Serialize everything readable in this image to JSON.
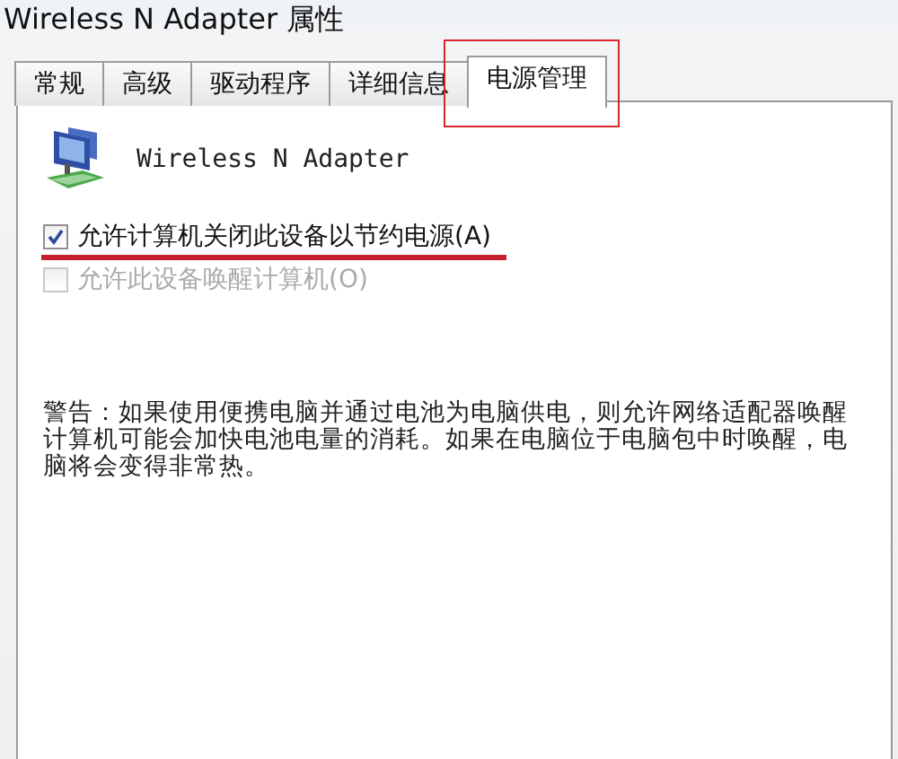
{
  "window": {
    "title": "Wireless N Adapter 属性"
  },
  "tabs": [
    {
      "label": "常规",
      "selected": false
    },
    {
      "label": "高级",
      "selected": false
    },
    {
      "label": "驱动程序",
      "selected": false
    },
    {
      "label": "详细信息",
      "selected": false
    },
    {
      "label": "电源管理",
      "selected": true
    }
  ],
  "device": {
    "name": "Wireless N Adapter"
  },
  "options": [
    {
      "label": "允许计算机关闭此设备以节约电源(A)",
      "checked": true,
      "disabled": false
    },
    {
      "label": "允许此设备唤醒计算机(O)",
      "checked": false,
      "disabled": true
    }
  ],
  "warning": "警告：如果使用便携电脑并通过电池为电脑供电，则允许网络适配器唤醒计算机可能会加快电池电量的消耗。如果在电脑位于电脑包中时唤醒，电脑将会变得非常热。"
}
